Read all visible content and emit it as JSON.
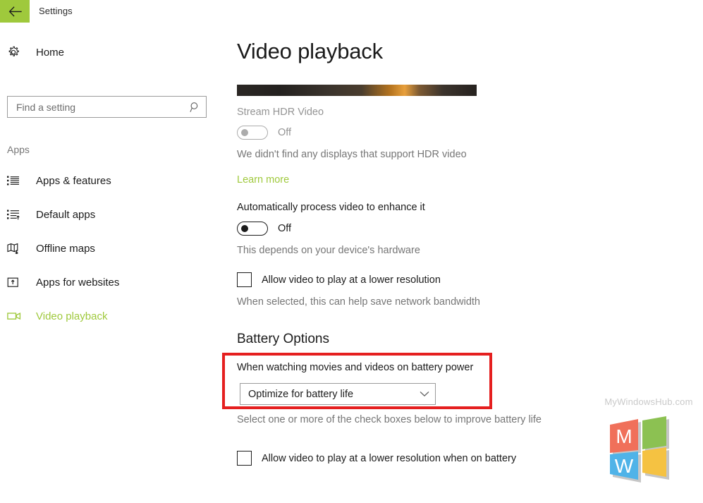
{
  "titlebar": {
    "back_icon": "back-arrow-icon",
    "title": "Settings",
    "accent_color": "#9fc93c"
  },
  "sidebar": {
    "home": {
      "icon": "gear-icon",
      "label": "Home"
    },
    "search": {
      "placeholder": "Find a setting",
      "value": "",
      "icon": "search-icon"
    },
    "group_label": "Apps",
    "items": [
      {
        "icon": "list-icon",
        "label": "Apps & features",
        "selected": false
      },
      {
        "icon": "list-arrow-icon",
        "label": "Default apps",
        "selected": false
      },
      {
        "icon": "map-download-icon",
        "label": "Offline maps",
        "selected": false
      },
      {
        "icon": "box-up-arrow-icon",
        "label": "Apps for websites",
        "selected": false
      },
      {
        "icon": "video-camera-icon",
        "label": "Video playback",
        "selected": true
      }
    ]
  },
  "main": {
    "page_title": "Video playback",
    "hdr": {
      "label": "Stream HDR Video",
      "state": "Off",
      "enabled": false,
      "description": "We didn't find any displays that support HDR video",
      "link": "Learn more"
    },
    "auto_process": {
      "label": "Automatically process video to enhance it",
      "state": "Off",
      "enabled": true,
      "description": "This depends on your device's hardware"
    },
    "lower_res": {
      "label": "Allow video to play at a lower resolution",
      "checked": false,
      "description": "When selected, this can help save network bandwidth"
    },
    "battery": {
      "heading": "Battery Options",
      "dropdown_label": "When watching movies and videos on battery power",
      "dropdown_value": "Optimize for battery life",
      "dropdown_icon": "chevron-down-icon",
      "description": "Select one or more of the check boxes below to improve battery life",
      "lower_res_battery": {
        "label": "Allow video to play at a lower resolution when on battery",
        "checked": false
      },
      "highlight_color": "#e51f1f"
    }
  },
  "watermark": {
    "text": "MyWindowsHub.com",
    "colors": {
      "m_tile": "#f0705a",
      "green_tile": "#8cc152",
      "w_tile": "#4fb3e8",
      "yellow_tile": "#f5c242"
    },
    "m_letter": "M",
    "w_letter": "W"
  }
}
